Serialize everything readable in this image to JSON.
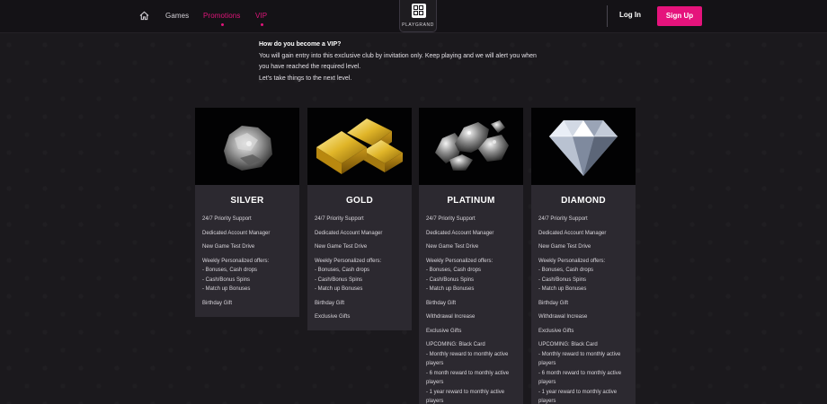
{
  "nav": {
    "games": "Games",
    "promotions": "Promotions",
    "vip": "VIP",
    "logo_text": "PLAYGRAND",
    "login": "Log In",
    "signup": "Sign Up",
    "accent_color": "#e5137c"
  },
  "intro": {
    "question": "How do you become a VIP?",
    "line1": "You will gain entry into this exclusive club by invitation only. Keep playing and we will alert you when",
    "line2": "you have reached the required level.",
    "line3": "Let's take things to the next level."
  },
  "tiers": [
    {
      "name": "SILVER",
      "image_icon": "silver-nugget-icon",
      "benefits": {
        "b1": "24/7 Priority Support",
        "b2": "Dedicated Account Manager",
        "b3": "New Game Test Drive",
        "b4a": "Weekly Personalized offers:",
        "b4b": "- Bonuses, Cash drops",
        "b4c": "- Cash/Bonus Spins",
        "b4d": "- Match up Bonuses",
        "b5": "Birthday Gift"
      }
    },
    {
      "name": "GOLD",
      "image_icon": "gold-bars-icon",
      "benefits": {
        "b1": "24/7 Priority Support",
        "b2": "Dedicated Account Manager",
        "b3": "New Game Test Drive",
        "b4a": "Weekly Personalized offers:",
        "b4b": "- Bonuses, Cash drops",
        "b4c": "- Cash/Bonus Spins",
        "b4d": "- Match up Bonuses",
        "b5": "Birthday Gift",
        "b6": "Exclusive Gifts"
      }
    },
    {
      "name": "PLATINUM",
      "image_icon": "platinum-nuggets-icon",
      "benefits": {
        "b1": "24/7 Priority Support",
        "b2": "Dedicated Account Manager",
        "b3": "New Game Test Drive",
        "b4a": "Weekly Personalized offers:",
        "b4b": "- Bonuses, Cash drops",
        "b4c": "- Cash/Bonus Spins",
        "b4d": "- Match up Bonuses",
        "b5": "Birthday Gift",
        "b6": "Withdrawal Increase",
        "b7": "Exclusive Gifts",
        "b8a": "UPCOMING: Black Card",
        "b8b": "- Monthly reward to monthly active",
        "b8c": "players",
        "b8d": "- 6 month reward to monthly active",
        "b8e": "players",
        "b8f": "- 1 year reward to monthly active",
        "b8g": "players"
      }
    },
    {
      "name": "DIAMOND",
      "image_icon": "diamond-icon",
      "benefits": {
        "b1": "24/7 Priority Support",
        "b2": "Dedicated Account Manager",
        "b3": "New Game Test Drive",
        "b4a": "Weekly Personalized offers:",
        "b4b": "- Bonuses, Cash drops",
        "b4c": "- Cash/Bonus Spins",
        "b4d": "- Match up Bonuses",
        "b5": "Birthday Gift",
        "b6": "Withdrawal Increase",
        "b7": "Exclusive Gifts",
        "b8a": "UPCOMING: Black Card",
        "b8b": "- Monthly reward to monthly active",
        "b8c": "players",
        "b8d": "- 6 month reward to monthly active",
        "b8e": "players",
        "b8f": "- 1 year reward to monthly active",
        "b8g": "players"
      }
    }
  ]
}
